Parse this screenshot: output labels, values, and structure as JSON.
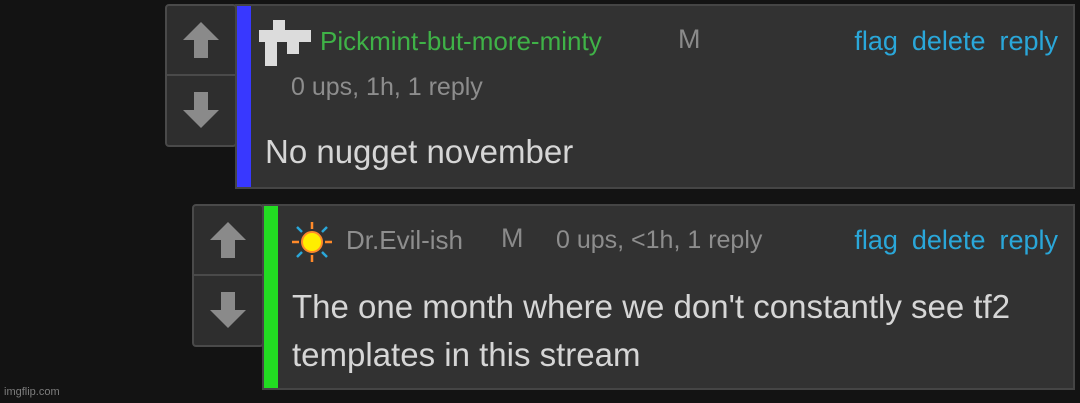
{
  "comments": [
    {
      "username": "Pickmint-but-more-minty",
      "mod_mark": "M",
      "meta": "0 ups, 1h, 1 reply",
      "actions": [
        "flag",
        "delete",
        "reply"
      ],
      "text": "No nugget november",
      "avatar_icon": "pixel-avatar-icon",
      "username_color": "#3fb247",
      "bar_color": "#3838ff"
    },
    {
      "username": "Dr.Evil-ish",
      "mod_mark": "M",
      "meta": "0 ups, <1h, 1 reply",
      "actions": [
        "flag",
        "delete",
        "reply"
      ],
      "text": "The one month where we don't constantly see tf2 templates in this stream",
      "avatar_icon": "sun-icon",
      "username_color": "#8e8e8e",
      "bar_color": "#22dd22"
    }
  ],
  "watermark": "imgflip.com"
}
